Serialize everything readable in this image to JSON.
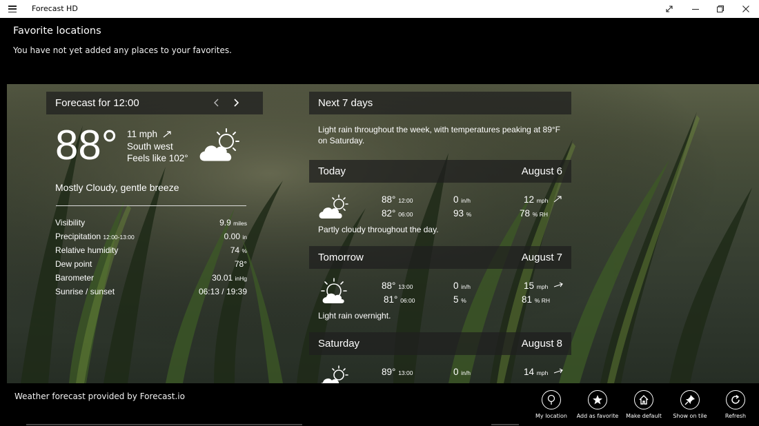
{
  "window": {
    "title": "Forecast HD",
    "icons": [
      "hamburger-icon",
      "expand-icon",
      "minimize-icon",
      "restore-icon",
      "close-icon"
    ]
  },
  "favorites": {
    "title": "Favorite locations",
    "empty_text": "You have not yet added any places to your favorites."
  },
  "current": {
    "header": "Forecast for 12:00",
    "temperature": "88°",
    "wind_speed": "11 mph",
    "wind_direction": "South west",
    "feels_like": "Feels like 102°",
    "summary": "Mostly Cloudy, gentle breeze",
    "details": [
      {
        "label": "Visibility",
        "sublabel": "",
        "value": "9.9",
        "unit": "miles"
      },
      {
        "label": "Precipitation",
        "sublabel": "12:00-13:00",
        "value": "0.00",
        "unit": "in"
      },
      {
        "label": "Relative humidity",
        "sublabel": "",
        "value": "74",
        "unit": "%"
      },
      {
        "label": "Dew point",
        "sublabel": "",
        "value": "78°",
        "unit": ""
      },
      {
        "label": "Barometer",
        "sublabel": "",
        "value": "30.01",
        "unit": "inHg"
      },
      {
        "label": "Sunrise / sunset",
        "sublabel": "",
        "value": "06:13 / 19:39",
        "unit": ""
      }
    ]
  },
  "week": {
    "header": "Next 7 days",
    "summary": "Light rain throughout the week, with temperatures peaking at 89°F on Saturday.",
    "days": [
      {
        "name": "Today",
        "date": "August 6",
        "high": "88°",
        "high_time": "12:00",
        "low": "82°",
        "low_time": "06:00",
        "precip": "0",
        "precip_unit": "in/h",
        "precip_prob": "93",
        "prob_unit": "%",
        "wind": "12",
        "wind_unit": "mph",
        "humidity": "78",
        "humidity_unit": "% RH",
        "description": "Partly cloudy throughout the day."
      },
      {
        "name": "Tomorrow",
        "date": "August 7",
        "high": "88°",
        "high_time": "13:00",
        "low": "81°",
        "low_time": "06:00",
        "precip": "0",
        "precip_unit": "in/h",
        "precip_prob": "5",
        "prob_unit": "%",
        "wind": "15",
        "wind_unit": "mph",
        "humidity": "81",
        "humidity_unit": "% RH",
        "description": "Light rain overnight."
      },
      {
        "name": "Saturday",
        "date": "August 8",
        "high": "89°",
        "high_time": "13:00",
        "precip": "0",
        "precip_unit": "in/h",
        "wind": "14",
        "wind_unit": "mph"
      }
    ]
  },
  "footer": {
    "credit": "Weather forecast provided by Forecast.io"
  },
  "appbar": {
    "buttons": [
      {
        "label": "My location",
        "icon": "location-pin-icon"
      },
      {
        "label": "Add as favorite",
        "icon": "star-icon"
      },
      {
        "label": "Make default",
        "icon": "home-icon"
      },
      {
        "label": "Show on tile",
        "icon": "pin-icon"
      },
      {
        "label": "Refresh",
        "icon": "refresh-icon"
      }
    ]
  }
}
